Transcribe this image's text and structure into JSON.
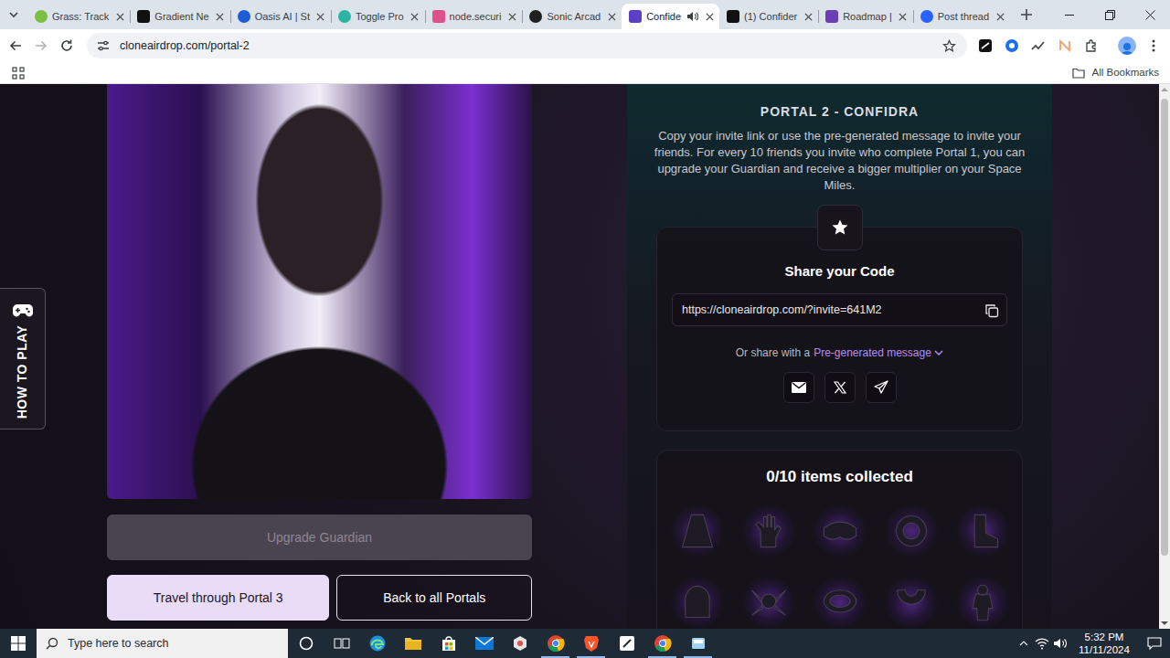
{
  "browser": {
    "tabs": [
      {
        "label": "Grass: Track",
        "selected": false,
        "audio": false
      },
      {
        "label": "Gradient Ne",
        "selected": false,
        "audio": false
      },
      {
        "label": "Oasis AI | St",
        "selected": false,
        "audio": false
      },
      {
        "label": "Toggle Pro",
        "selected": false,
        "audio": false
      },
      {
        "label": "node.securi",
        "selected": false,
        "audio": false
      },
      {
        "label": "Sonic Arcad",
        "selected": false,
        "audio": false
      },
      {
        "label": "Confide",
        "selected": true,
        "audio": true
      },
      {
        "label": "(1) Confider",
        "selected": false,
        "audio": false
      },
      {
        "label": "Roadmap |",
        "selected": false,
        "audio": false
      },
      {
        "label": "Post thread",
        "selected": false,
        "audio": false
      }
    ],
    "address": "cloneairdrop.com/portal-2",
    "bookmarks_folder": "All Bookmarks"
  },
  "page": {
    "side_tab": "HOW TO PLAY",
    "portal_title": "PORTAL 2 - CONFIDRA",
    "description": "Copy your invite link or use the pre-generated message to invite your friends. For every 10 friends you invite who complete Portal 1, you can upgrade your Guardian and receive a bigger multiplier on your Space Miles.",
    "share_title": "Share your Code",
    "invite_link": "https://cloneairdrop.com/?invite=641M2",
    "share_prefix": "Or share with a",
    "share_dropdown": {
      "label": "Pre-generated message",
      "expanded": false
    },
    "items_count": "0/10 items collected",
    "items": [
      {
        "collected": false
      },
      {
        "collected": false
      },
      {
        "collected": false
      },
      {
        "collected": false
      },
      {
        "collected": false
      },
      {
        "collected": false
      },
      {
        "collected": false
      },
      {
        "collected": false
      },
      {
        "collected": false
      },
      {
        "collected": false
      }
    ],
    "buttons": [
      {
        "label": "Upgrade Guardian",
        "kind": "primary",
        "disabled": true
      },
      {
        "label": "Travel through Portal 3",
        "kind": "primary",
        "disabled": false
      },
      {
        "label": "Back to all Portals",
        "kind": "outline",
        "disabled": false
      }
    ]
  },
  "taskbar": {
    "search_placeholder": "Type here to search",
    "time": "5:32 PM",
    "date": "11/11/2024"
  }
}
